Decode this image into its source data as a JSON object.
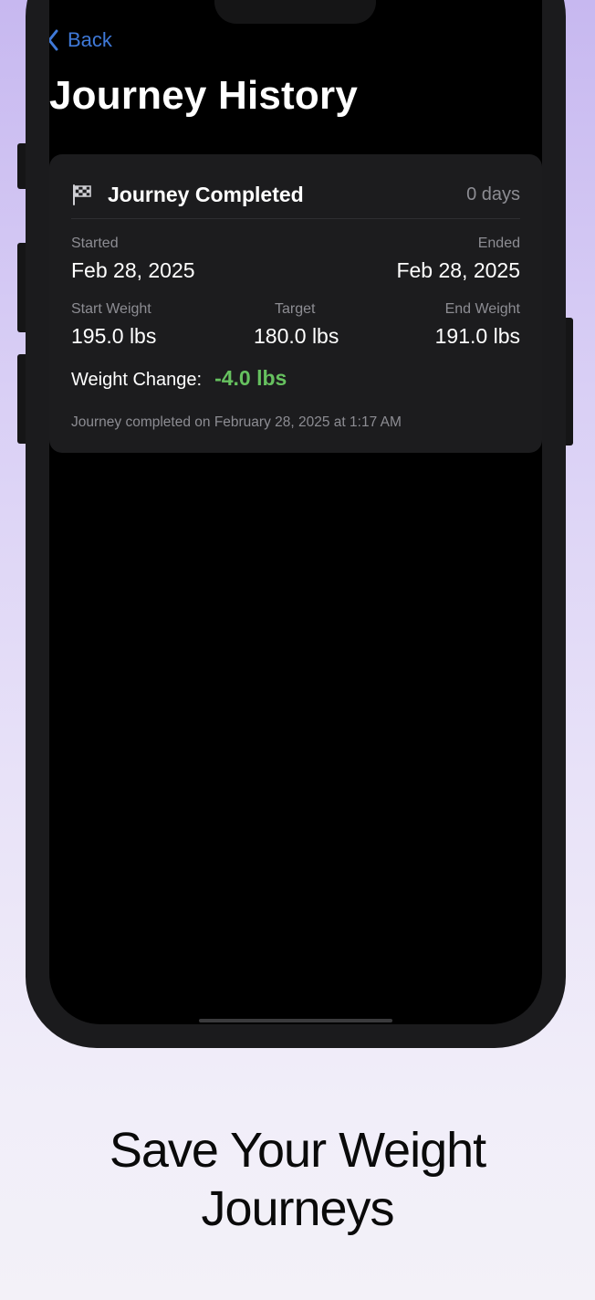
{
  "nav": {
    "back_label": "Back"
  },
  "page": {
    "title": "Journey History"
  },
  "journey_card": {
    "title": "Journey Completed",
    "icon": "checkered-flag-icon",
    "duration": "0 days",
    "started_label": "Started",
    "started_value": "Feb 28, 2025",
    "ended_label": "Ended",
    "ended_value": "Feb 28, 2025",
    "start_weight_label": "Start Weight",
    "start_weight_value": "195.0 lbs",
    "target_label": "Target",
    "target_value": "180.0 lbs",
    "end_weight_label": "End Weight",
    "end_weight_value": "191.0 lbs",
    "weight_change_label": "Weight Change:",
    "weight_change_value": "-4.0 lbs",
    "completed_note": "Journey completed on February 28, 2025 at 1:17 AM"
  },
  "caption": {
    "line1": "Save Your Weight",
    "line2": "Journeys"
  },
  "colors": {
    "accent_blue": "#3f79d8",
    "positive_green": "#66c15f",
    "card_bg": "#1c1c1e",
    "secondary_text": "#8d8d93"
  }
}
